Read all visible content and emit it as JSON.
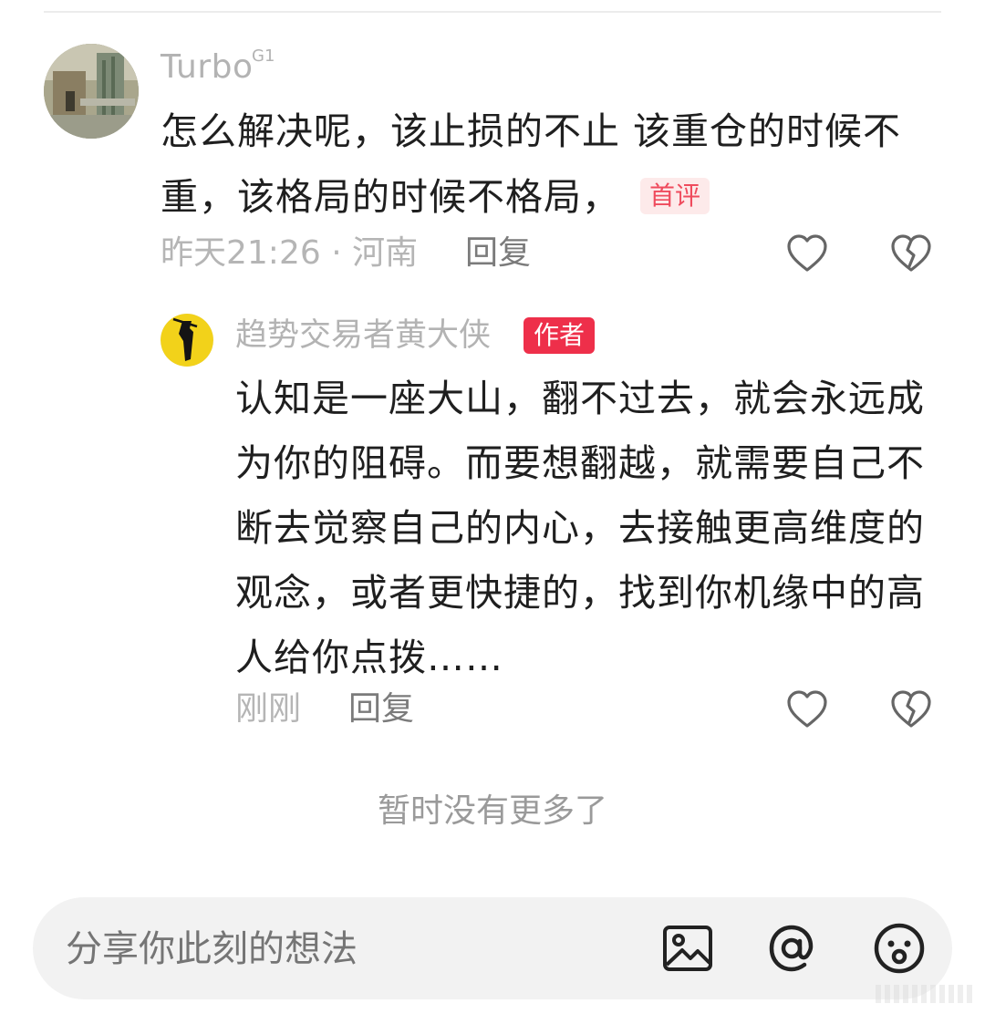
{
  "comment": {
    "username": "Turbo",
    "user_badge": "G1",
    "text": "怎么解决呢，该止损的不止 该重仓的时候不重，该格局的时候不格局，",
    "first_comment_badge": "首评",
    "meta": "昨天21:26 · 河南",
    "reply_label": "回复"
  },
  "reply": {
    "username": "趋势交易者黄大侠",
    "author_badge": "作者",
    "text": "认知是一座大山，翻不过去，就会永远成为你的阻碍。而要想翻越，就需要自己不断去觉察自己的内心，去接触更高维度的观念，或者更快捷的，找到你机缘中的高人给你点拨……",
    "meta": "刚刚",
    "reply_label": "回复"
  },
  "footer": {
    "no_more": "暂时没有更多了"
  },
  "input_bar": {
    "placeholder": "分享你此刻的想法",
    "icons": [
      "image-icon",
      "at-icon",
      "emoji-icon"
    ]
  },
  "colors": {
    "accent_red": "#ee2f4a",
    "first_badge_text": "#ef4b5d",
    "first_badge_bg": "#fdeaea",
    "muted_text": "#b3b3b3"
  }
}
